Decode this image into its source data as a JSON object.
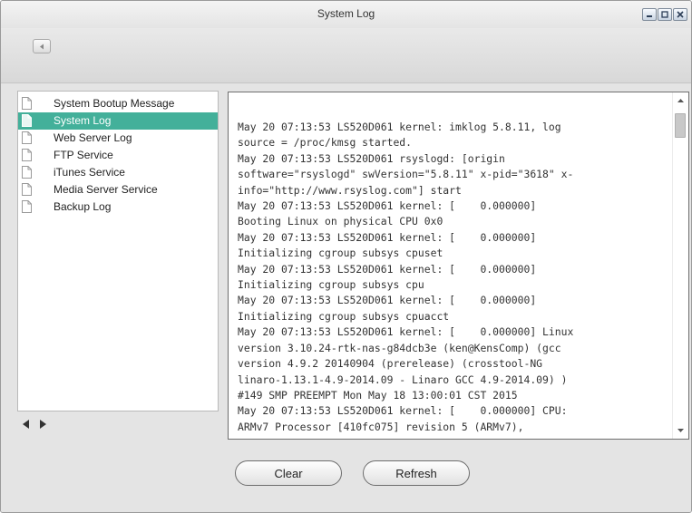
{
  "window": {
    "title": "System Log"
  },
  "toolbar": {
    "back_icon": "chevron-left-icon"
  },
  "sidebar": {
    "items": [
      {
        "label": "System Bootup Message",
        "selected": false
      },
      {
        "label": "System Log",
        "selected": true
      },
      {
        "label": "Web Server Log",
        "selected": false
      },
      {
        "label": "FTP Service",
        "selected": false
      },
      {
        "label": "iTunes Service",
        "selected": false
      },
      {
        "label": "Media Server Service",
        "selected": false
      },
      {
        "label": "Backup Log",
        "selected": false
      }
    ]
  },
  "log": {
    "text": "May 20 07:13:53 LS520D061 kernel: imklog 5.8.11, log\nsource = /proc/kmsg started.\nMay 20 07:13:53 LS520D061 rsyslogd: [origin\nsoftware=\"rsyslogd\" swVersion=\"5.8.11\" x-pid=\"3618\" x-\ninfo=\"http://www.rsyslog.com\"] start\nMay 20 07:13:53 LS520D061 kernel: [    0.000000]\nBooting Linux on physical CPU 0x0\nMay 20 07:13:53 LS520D061 kernel: [    0.000000]\nInitializing cgroup subsys cpuset\nMay 20 07:13:53 LS520D061 kernel: [    0.000000]\nInitializing cgroup subsys cpu\nMay 20 07:13:53 LS520D061 kernel: [    0.000000]\nInitializing cgroup subsys cpuacct\nMay 20 07:13:53 LS520D061 kernel: [    0.000000] Linux\nversion 3.10.24-rtk-nas-g84dcb3e (ken@KensComp) (gcc\nversion 4.9.2 20140904 (prerelease) (crosstool-NG\nlinaro-1.13.1-4.9-2014.09 - Linaro GCC 4.9-2014.09) )\n#149 SMP PREEMPT Mon May 18 13:00:01 CST 2015\nMay 20 07:13:53 LS520D061 kernel: [    0.000000] CPU:\nARMv7 Processor [410fc075] revision 5 (ARMv7),"
  },
  "buttons": {
    "clear": "Clear",
    "refresh": "Refresh"
  },
  "colors": {
    "selection": "#43b09a",
    "background": "#e4e4e4"
  }
}
